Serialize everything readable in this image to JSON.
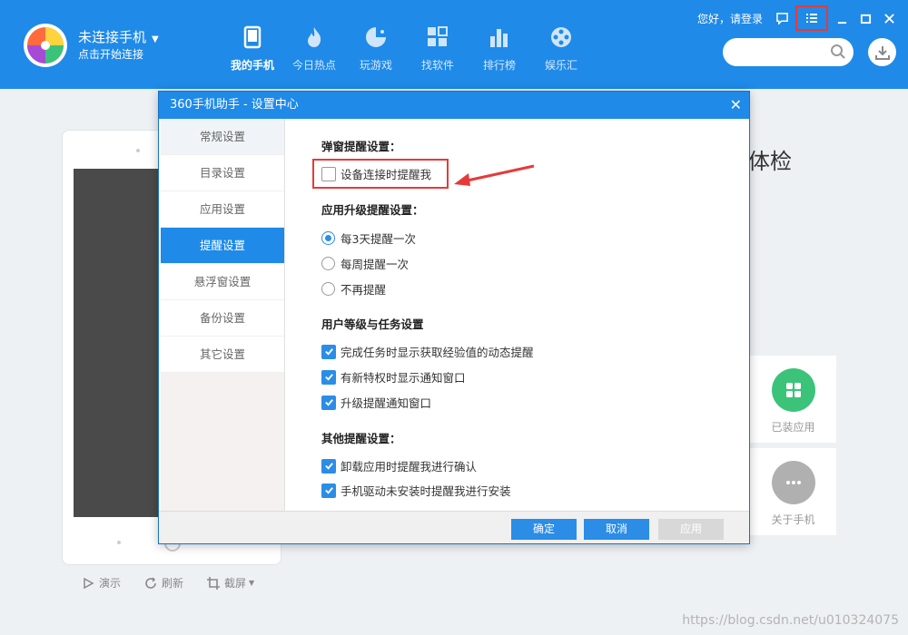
{
  "header": {
    "phone_status": "未连接手机",
    "phone_sub": "点击开始连接",
    "login_text": "您好，请登录",
    "nav": [
      {
        "label": "我的手机",
        "icon": "phone-icon"
      },
      {
        "label": "今日热点",
        "icon": "flame-icon"
      },
      {
        "label": "玩游戏",
        "icon": "game-icon"
      },
      {
        "label": "找软件",
        "icon": "apps-icon"
      },
      {
        "label": "排行榜",
        "icon": "ranking-icon"
      },
      {
        "label": "娱乐汇",
        "icon": "film-reel-icon"
      }
    ],
    "search_placeholder": ""
  },
  "background": {
    "check_title": "体检",
    "cards": [
      {
        "label": "已装应用",
        "icon": "grid-icon",
        "color": "#3cc37a"
      },
      {
        "label": "关于手机",
        "icon": "more-icon",
        "color": "#b0b0b0"
      }
    ],
    "tools": [
      {
        "label": "演示",
        "icon": "play-icon"
      },
      {
        "label": "刷新",
        "icon": "refresh-icon"
      },
      {
        "label": "截屏",
        "icon": "crop-icon"
      }
    ],
    "watermark": "https://blog.csdn.net/u010324075"
  },
  "dialog": {
    "title": "360手机助手 - 设置中心",
    "sidebar": [
      {
        "label": "常规设置"
      },
      {
        "label": "目录设置"
      },
      {
        "label": "应用设置"
      },
      {
        "label": "提醒设置"
      },
      {
        "label": "悬浮窗设置"
      },
      {
        "label": "备份设置"
      },
      {
        "label": "其它设置"
      }
    ],
    "sections": {
      "popup_title": "弹窗提醒设置：",
      "popup_option": "设备连接时提醒我",
      "upgrade_title": "应用升级提醒设置：",
      "upgrade_options": [
        "每3天提醒一次",
        "每周提醒一次",
        "不再提醒"
      ],
      "user_title": "用户等级与任务设置",
      "user_options": [
        "完成任务时显示获取经验值的动态提醒",
        "有新特权时显示通知窗口",
        "升级提醒通知窗口"
      ],
      "other_title": "其他提醒设置：",
      "other_options": [
        "卸载应用时提醒我进行确认",
        "手机驱动未安装时提醒我进行安装"
      ]
    },
    "buttons": {
      "ok": "确定",
      "cancel": "取消",
      "apply": "应用"
    }
  },
  "colors": {
    "brand_blue": "#1f8ae8",
    "highlight_red": "#e63a3a"
  }
}
